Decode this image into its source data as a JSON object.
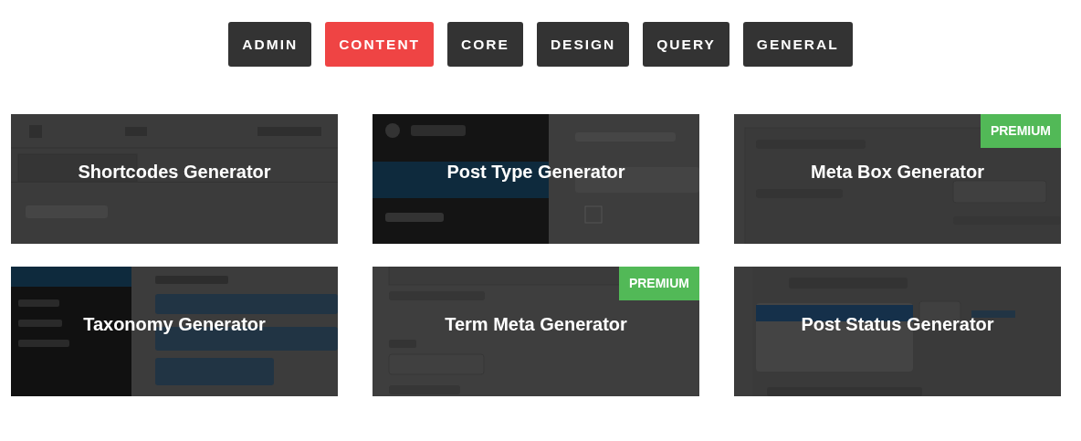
{
  "filters": [
    {
      "label": "ADMIN",
      "selected": false
    },
    {
      "label": "CONTENT",
      "selected": true
    },
    {
      "label": "CORE",
      "selected": false
    },
    {
      "label": "DESIGN",
      "selected": false
    },
    {
      "label": "QUERY",
      "selected": false
    },
    {
      "label": "GENERAL",
      "selected": false
    }
  ],
  "cards": [
    {
      "title": "Shortcodes Generator",
      "premium": false
    },
    {
      "title": "Post Type Generator",
      "premium": false
    },
    {
      "title": "Meta Box Generator",
      "premium": true,
      "badge": "PREMIUM"
    },
    {
      "title": "Taxonomy Generator",
      "premium": false
    },
    {
      "title": "Term Meta Generator",
      "premium": true,
      "badge": "PREMIUM"
    },
    {
      "title": "Post Status Generator",
      "premium": false
    }
  ]
}
